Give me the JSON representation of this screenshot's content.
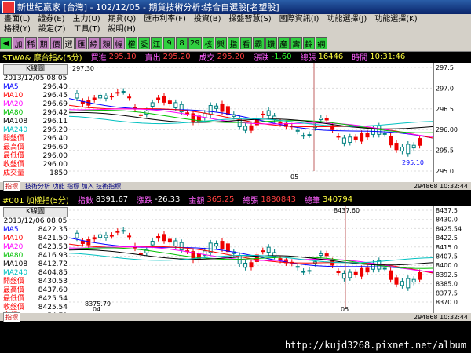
{
  "window": {
    "title": "新世紀贏家 [台灣] - 102/12/05 - 期貨技術分析:綜合自選股[名望股]"
  },
  "menu": {
    "row1": [
      "畫面(L)",
      "證券(E)",
      "主力(U)",
      "期貨(Q)",
      "匯市利率(F)",
      "投資(B)",
      "操盤智慧(S)",
      "國際資訊(I)",
      "功能選擇(J)",
      "功能選擇(K)"
    ],
    "row2": [
      "格視(Y)",
      "設定(Z)",
      "工具(T)",
      "說明(H)"
    ]
  },
  "toolbar": {
    "buttons": [
      {
        "label": "◀",
        "color": "#30d040"
      },
      {
        "label": "加",
        "color": "#c080c0"
      },
      {
        "label": "稀",
        "color": "#c080c0"
      },
      {
        "label": "期",
        "color": "#c080c0"
      },
      {
        "label": "價",
        "color": "#c080c0"
      },
      {
        "label": "選",
        "color": "#d4d0c8"
      },
      {
        "label": "匯",
        "color": "#c080c0"
      },
      {
        "label": "綜",
        "color": "#c080c0"
      },
      {
        "label": "類",
        "color": "#c080c0"
      },
      {
        "label": "幅",
        "color": "#c080c0"
      },
      {
        "label": "權",
        "color": "#30d040"
      },
      {
        "label": "委",
        "color": "#30d040"
      },
      {
        "label": "江",
        "color": "#30d040"
      },
      {
        "label": "9",
        "color": "#30d040"
      },
      {
        "label": "8",
        "color": "#30d040"
      },
      {
        "label": "29",
        "color": "#30d040"
      },
      {
        "label": "核",
        "color": "#30d040"
      },
      {
        "label": "興",
        "color": "#30d040"
      },
      {
        "label": "指",
        "color": "#30d040"
      },
      {
        "label": "看",
        "color": "#30d040"
      },
      {
        "label": "霸",
        "color": "#30d040"
      },
      {
        "label": "鑽",
        "color": "#30d040"
      },
      {
        "label": "產",
        "color": "#30d040"
      },
      {
        "label": "壽",
        "color": "#30d040"
      },
      {
        "label": "鈴",
        "color": "#30d040"
      },
      {
        "label": "網",
        "color": "#30d040"
      }
    ]
  },
  "upper": {
    "symbol": "STWA& 摩台指&(5分)",
    "buy_label": "買進",
    "buy": "295.10",
    "sell_label": "賣出",
    "sell": "295.20",
    "deal_label": "成交",
    "deal": "295.20",
    "chg_label": "漲跌",
    "chg": "-1.60",
    "vol_label": "總張",
    "vol": "16446",
    "time_label": "時間",
    "time": "10:31:46",
    "legend": {
      "kline": "K線圖",
      "date": "2013/12/05 08:05",
      "rows": [
        {
          "label": "MA5",
          "value": "296.40",
          "color": "#0000ff"
        },
        {
          "label": "MA10",
          "value": "296.45",
          "color": "#ff0000"
        },
        {
          "label": "MA20",
          "value": "296.69",
          "color": "#ff00ff"
        },
        {
          "label": "MA80",
          "value": "296.42",
          "color": "#00c000"
        },
        {
          "label": "MA108",
          "value": "296.11",
          "color": "#000000"
        },
        {
          "label": "MA240",
          "value": "296.20",
          "color": "#00c0c0"
        },
        {
          "label": "開盤價",
          "value": "296.40",
          "color": "#ff0000"
        },
        {
          "label": "最高價",
          "value": "296.60",
          "color": "#ff0000"
        },
        {
          "label": "最低價",
          "value": "296.00",
          "color": "#ff0000"
        },
        {
          "label": "收盤價",
          "value": "296.00",
          "color": "#ff0000"
        },
        {
          "label": "成交量",
          "value": "1850",
          "color": "#ff0000"
        }
      ]
    },
    "y_ticks": [
      "297.5",
      "297.0",
      "296.5",
      "296.00",
      "295.5",
      "295.0"
    ],
    "high_mark": "297.30",
    "low_mark": "295.10",
    "x_tick": "05",
    "strip_btn": "指標",
    "strip_text": "技術分析 功能 指標 加入 技術指標",
    "strip_right": "294868 10:32:44"
  },
  "lower": {
    "symbol": "#001 加權指(5分)",
    "idx_label": "指數",
    "idx": "8391.67",
    "chg_label": "漲跌",
    "chg": "-26.33",
    "amt_label": "金額",
    "amt": "365.25",
    "vol_label": "總張",
    "vol": "1880843",
    "trades_label": "總筆",
    "trades": "340794",
    "legend": {
      "kline": "K線圖",
      "date": "2013/12/06 08:05",
      "rows": [
        {
          "label": "MA5",
          "value": "8422.35",
          "color": "#0000ff"
        },
        {
          "label": "MA10",
          "value": "8421.50",
          "color": "#ff0000"
        },
        {
          "label": "MA20",
          "value": "8423.53",
          "color": "#ff00ff"
        },
        {
          "label": "MA80",
          "value": "8416.93",
          "color": "#00c000"
        },
        {
          "label": "MA108",
          "value": "8412.72",
          "color": "#000000"
        },
        {
          "label": "MA240",
          "value": "8404.85",
          "color": "#00c0c0"
        },
        {
          "label": "開盤價",
          "value": "8430.53",
          "color": "#ff0000"
        },
        {
          "label": "最高價",
          "value": "8437.60",
          "color": "#ff0000"
        },
        {
          "label": "最低價",
          "value": "8425.54",
          "color": "#ff0000"
        },
        {
          "label": "收盤價",
          "value": "8425.54",
          "color": "#ff0000"
        },
        {
          "label": "金額",
          "value": "54.71",
          "color": "#ff0000"
        }
      ]
    },
    "y_ticks": [
      "8437.5",
      "8430.0",
      "8425.54",
      "8422.5",
      "8415.0",
      "8407.5",
      "8400.0",
      "8392.5",
      "8385.0",
      "8377.5",
      "8370.0"
    ],
    "high_mark": "8437.60",
    "low_mark": "8375.79",
    "x_ticks": [
      "04",
      "05"
    ],
    "strip_btn": "指標",
    "strip_text": "",
    "strip_right": "294868 10:32:44"
  },
  "statusbar": {
    "url": "http://kujd3268.pixnet.net/album"
  }
}
